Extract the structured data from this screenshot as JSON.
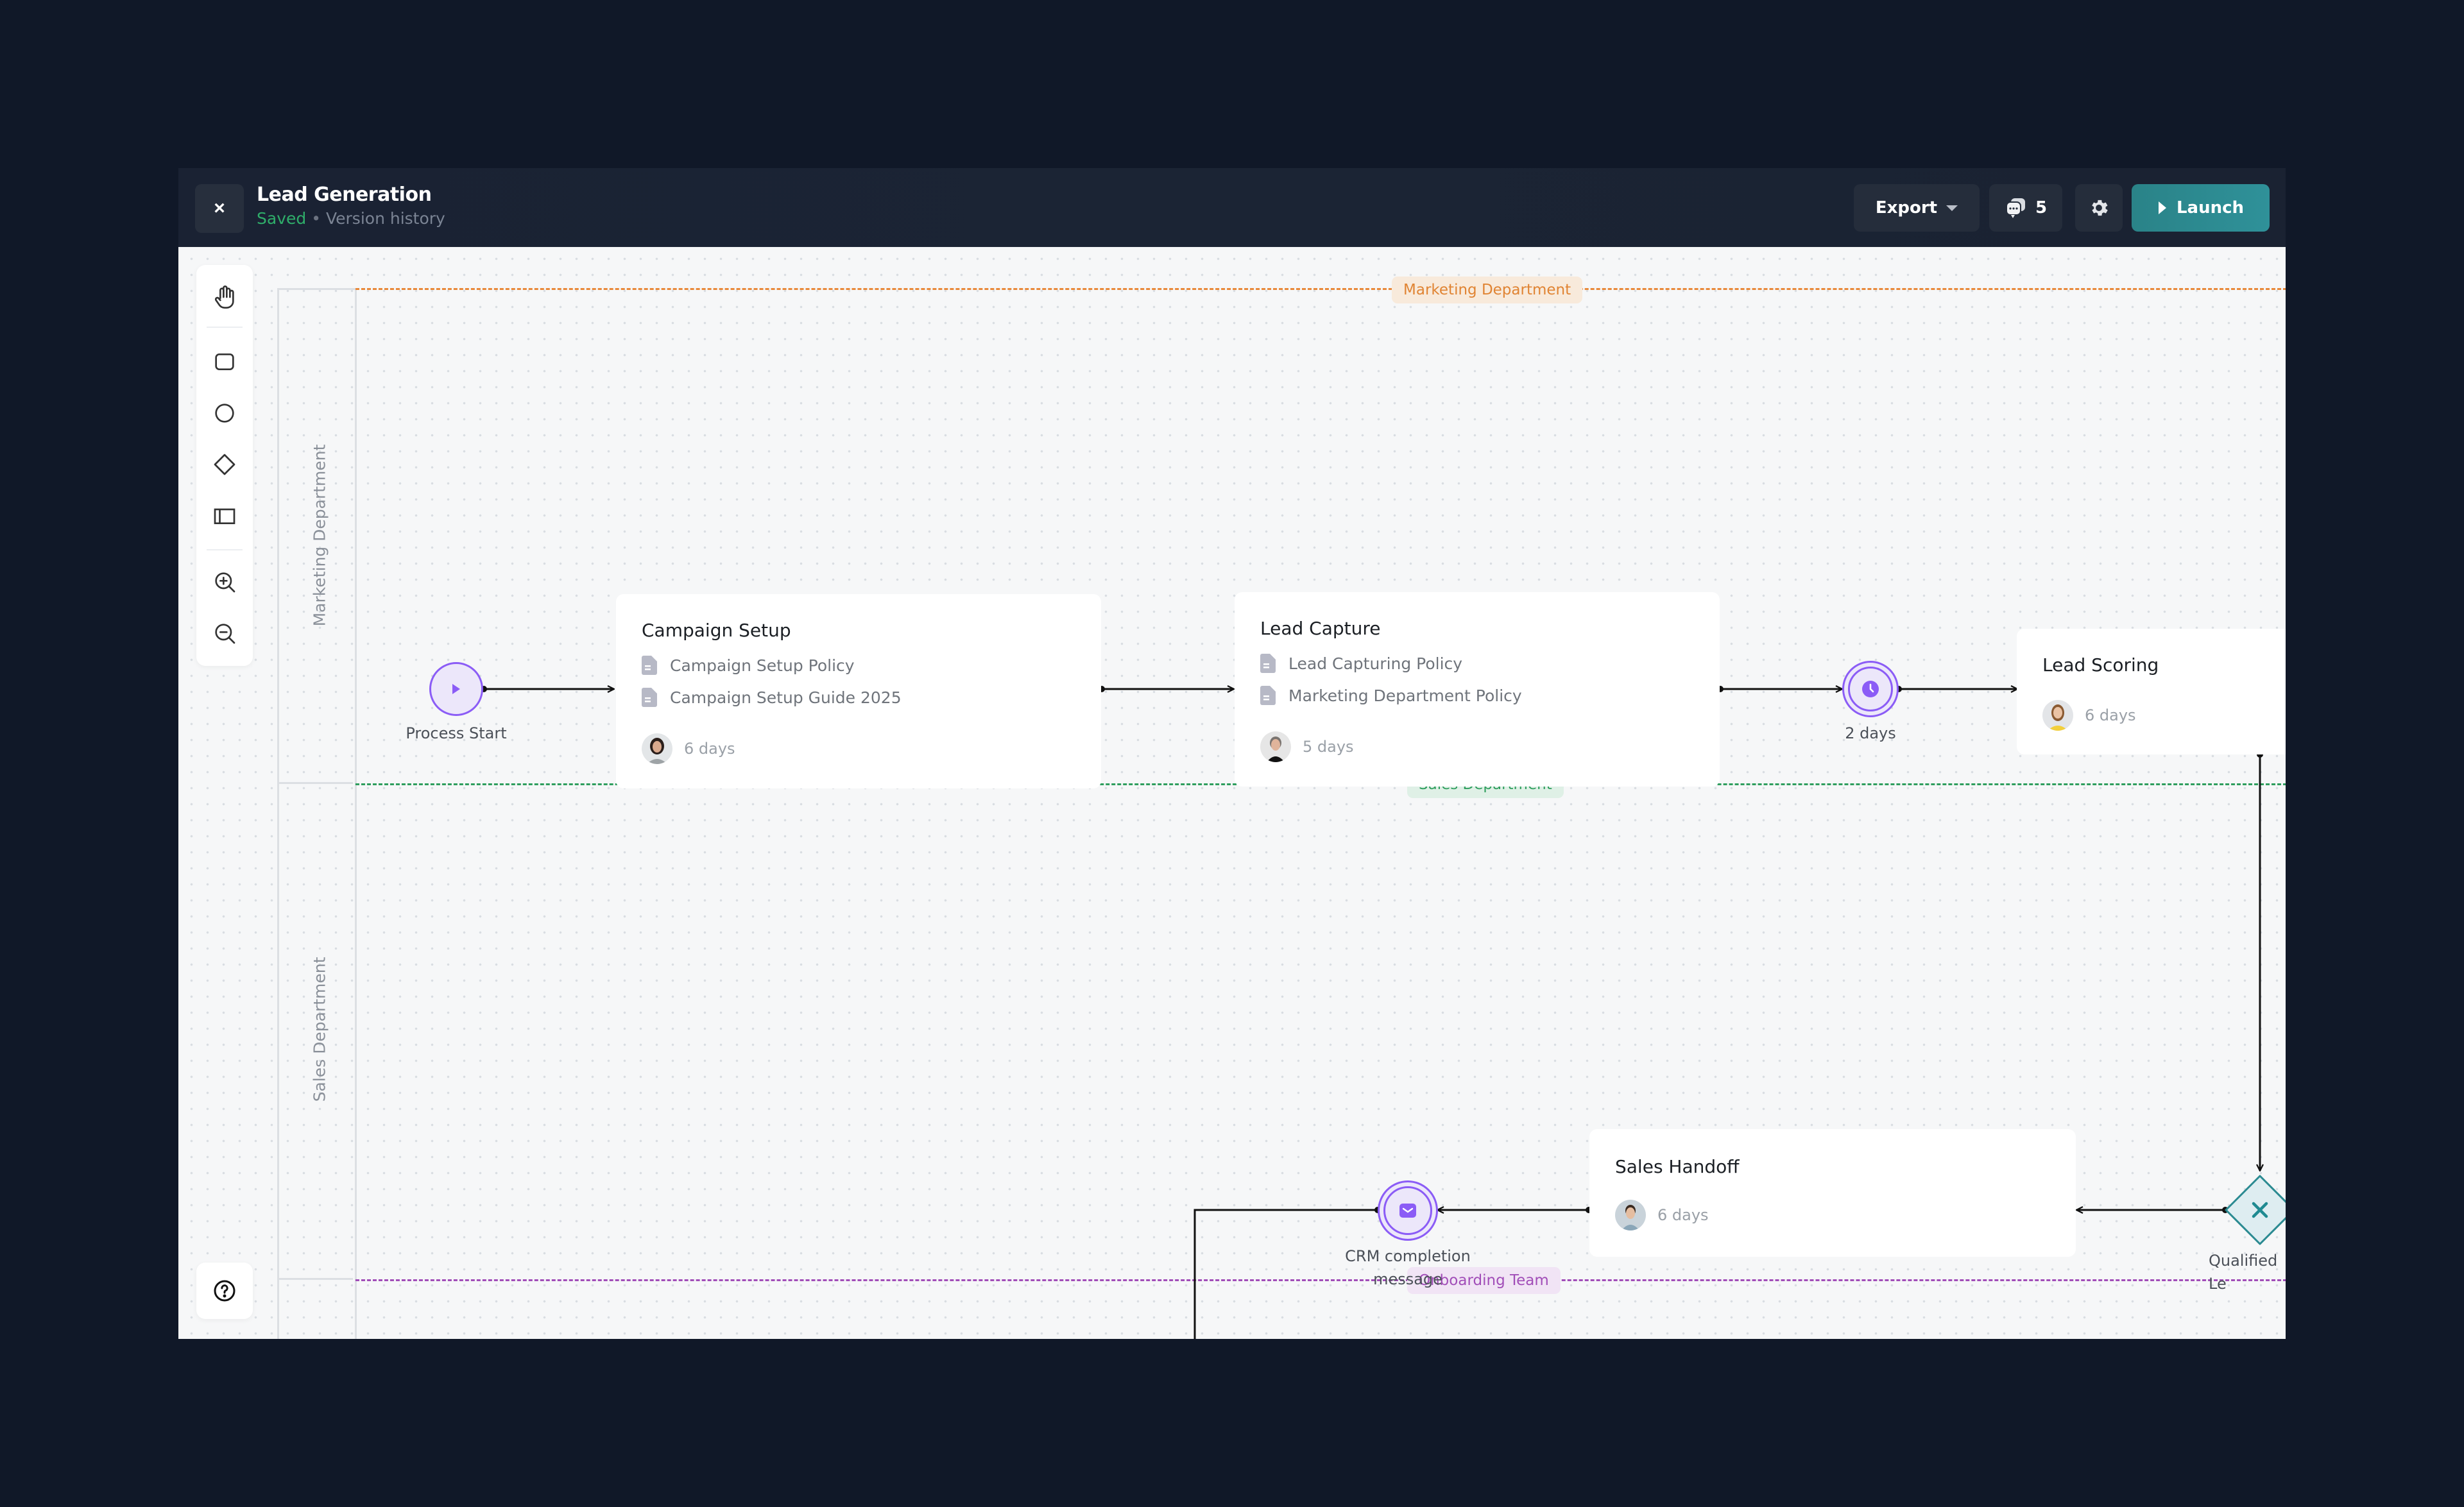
{
  "header": {
    "close_label": "×",
    "title": "Lead Generation",
    "status": "Saved",
    "separator": "•",
    "version_history": "Version history",
    "export_label": "Export",
    "comments_count": "5",
    "launch_label": "Launch"
  },
  "toolbar": {
    "tools": [
      "hand-tool",
      "rectangle-tool",
      "circle-tool",
      "diamond-tool",
      "lane-tool",
      "zoom-in",
      "zoom-out"
    ]
  },
  "lanes": [
    {
      "name": "Marketing Department",
      "color": "#e8893a",
      "tag_bg": "#f8eadb"
    },
    {
      "name": "Sales Department",
      "color": "#2f9e5e",
      "tag_bg": "#dff0e6"
    },
    {
      "name": "Onboarding Team",
      "color": "#a14db8",
      "tag_bg": "#f1e4f5"
    }
  ],
  "nodes": {
    "process_start": {
      "label": "Process Start"
    },
    "campaign_setup": {
      "title": "Campaign Setup",
      "documents": [
        "Campaign Setup Policy",
        "Campaign Setup Guide 2025"
      ],
      "duration": "6 days"
    },
    "lead_capture": {
      "title": "Lead Capture",
      "documents": [
        "Lead Capturing Policy",
        "Marketing Department Policy"
      ],
      "duration": "5 days"
    },
    "timer": {
      "label": "2 days"
    },
    "lead_scoring": {
      "title": "Lead Scoring",
      "duration": "6 days"
    },
    "qualified_lead": {
      "label": "Qualified Le"
    },
    "sales_handoff": {
      "title": "Sales Handoff",
      "duration": "6 days"
    },
    "crm_message": {
      "label_line1": "CRM completion",
      "label_line2": "message"
    }
  },
  "colors": {
    "accent_purple": "#8b5cf6",
    "accent_teal": "#2a8a91",
    "saved_green": "#2fae6a"
  }
}
